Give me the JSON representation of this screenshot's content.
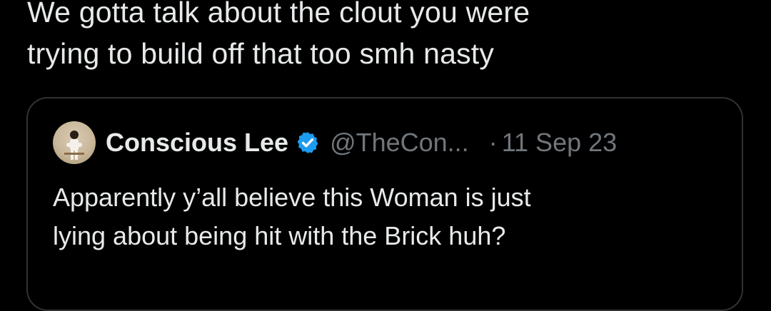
{
  "tweet": {
    "text_lines": [
      "We gotta talk about the clout you were",
      "trying to build off that too smh nasty"
    ]
  },
  "quoted_tweet": {
    "author": {
      "display_name": "Conscious Lee",
      "handle": "@TheCon...",
      "verified": true,
      "verified_color": "#1d9bf0"
    },
    "separator": "·",
    "timestamp": "11 Sep 23",
    "text_lines": [
      "Apparently y’all believe this Woman is just",
      "lying about being hit with the Brick huh?"
    ]
  },
  "colors": {
    "background": "#000000",
    "primary_text": "#e7e9ea",
    "secondary_text": "#71767b",
    "border": "#2f3336"
  },
  "icons": {
    "verified": "verified-badge-icon"
  }
}
